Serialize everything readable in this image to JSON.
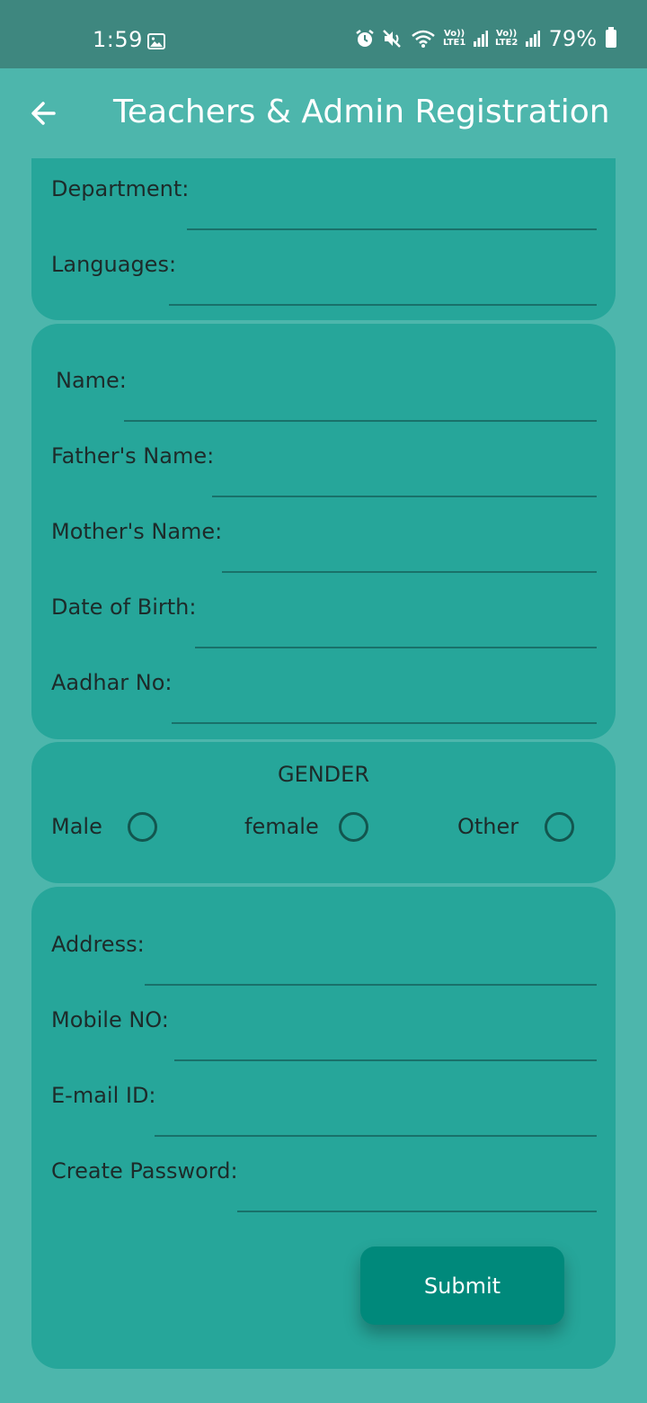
{
  "status_bar": {
    "time": "1:59",
    "net1": "Vo)) LTE1",
    "net2": "Vo)) LTE2",
    "battery": "79%"
  },
  "app_bar": {
    "title": "Teachers & Admin Registration"
  },
  "top_section": {
    "department_label": "Department:",
    "languages_label": "Languages:"
  },
  "personal_section": {
    "name_label": "Name:",
    "father_label": "Father's Name:",
    "mother_label": "Mother's Name:",
    "dob_label": "Date of Birth:",
    "aadhar_label": "Aadhar No:"
  },
  "gender_section": {
    "title": "GENDER",
    "options": [
      {
        "label": "Male",
        "selected": false
      },
      {
        "label": "female",
        "selected": false
      },
      {
        "label": "Other",
        "selected": false
      }
    ]
  },
  "contact_section": {
    "address_label": "Address:",
    "mobile_label": "Mobile NO:",
    "email_label": "E-mail ID:",
    "password_label": "Create Password:",
    "submit_label": "Submit"
  },
  "colors": {
    "background": "#4db6ac",
    "status_bar": "#3e877f",
    "card": "#26a69a",
    "button": "#00897b",
    "underline": "#19716a"
  }
}
